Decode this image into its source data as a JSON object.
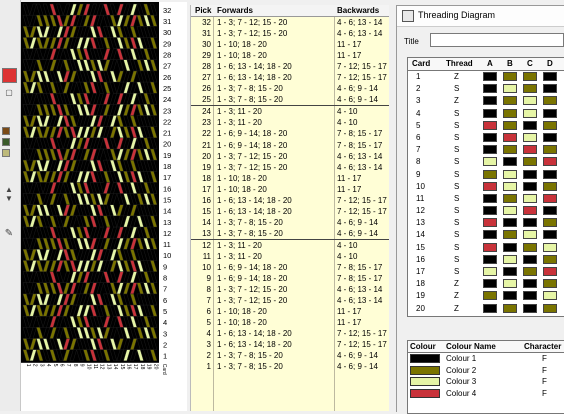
{
  "colors": {
    "colour1": "#000000",
    "colour2": "#7a7400",
    "colour3": "#e6f5a6",
    "colour4": "#c8323a"
  },
  "toolstrip": {
    "icons": [
      "current-colour-red-swatch",
      "colour-swap-icon",
      "palette-swatches-icon",
      "spin-up-icon",
      "spin-down-icon",
      "stamp-tool-icon"
    ]
  },
  "pattern": {
    "row_labels": [
      "32",
      "31",
      "30",
      "29",
      "28",
      "27",
      "26",
      "25",
      "24",
      "23",
      "22",
      "21",
      "20",
      "19",
      "18",
      "17",
      "16",
      "15",
      "14",
      "13",
      "12",
      "11",
      "10",
      "9",
      "8",
      "7",
      "6",
      "5",
      "4",
      "3",
      "2",
      "1"
    ],
    "card_labels": [
      "1",
      "2",
      "3",
      "4",
      "5",
      "6",
      "7",
      "8",
      "9",
      "10",
      "11",
      "12",
      "13",
      "14",
      "15",
      "16",
      "17",
      "18",
      "19",
      "20"
    ],
    "corner_label": "Card"
  },
  "pick_table": {
    "headers": {
      "pick": "Pick",
      "forwards": "Forwards",
      "backwards": "Backwards"
    },
    "rows": [
      {
        "pick": "32",
        "fw": "1 - 3; 7 - 12; 15 - 20",
        "bw": "4 - 6; 13 - 14"
      },
      {
        "pick": "31",
        "fw": "1 - 3; 7 - 12; 15 - 20",
        "bw": "4 - 6; 13 - 14"
      },
      {
        "pick": "30",
        "fw": "1 - 10; 18 - 20",
        "bw": "11 - 17"
      },
      {
        "pick": "29",
        "fw": "1 - 10; 18 - 20",
        "bw": "11 - 17"
      },
      {
        "pick": "28",
        "fw": "1 - 6; 13 - 14; 18 - 20",
        "bw": "7 - 12; 15 - 17"
      },
      {
        "pick": "27",
        "fw": "1 - 6; 13 - 14; 18 - 20",
        "bw": "7 - 12; 15 - 17"
      },
      {
        "pick": "26",
        "fw": "1 - 3; 7 - 8; 15 - 20",
        "bw": "4 - 6; 9 - 14"
      },
      {
        "pick": "25",
        "fw": "1 - 3; 7 - 8; 15 - 20",
        "bw": "4 - 6; 9 - 14",
        "sep": true
      },
      {
        "pick": "24",
        "fw": "1 - 3; 11 - 20",
        "bw": "4 - 10"
      },
      {
        "pick": "23",
        "fw": "1 - 3; 11 - 20",
        "bw": "4 - 10"
      },
      {
        "pick": "22",
        "fw": "1 - 6; 9 - 14; 18 - 20",
        "bw": "7 - 8; 15 - 17"
      },
      {
        "pick": "21",
        "fw": "1 - 6; 9 - 14; 18 - 20",
        "bw": "7 - 8; 15 - 17"
      },
      {
        "pick": "20",
        "fw": "1 - 3; 7 - 12; 15 - 20",
        "bw": "4 - 6; 13 - 14"
      },
      {
        "pick": "19",
        "fw": "1 - 3; 7 - 12; 15 - 20",
        "bw": "4 - 6; 13 - 14"
      },
      {
        "pick": "18",
        "fw": "1 - 10; 18 - 20",
        "bw": "11 - 17"
      },
      {
        "pick": "17",
        "fw": "1 - 10; 18 - 20",
        "bw": "11 - 17"
      },
      {
        "pick": "16",
        "fw": "1 - 6; 13 - 14; 18 - 20",
        "bw": "7 - 12; 15 - 17"
      },
      {
        "pick": "15",
        "fw": "1 - 6; 13 - 14; 18 - 20",
        "bw": "7 - 12; 15 - 17"
      },
      {
        "pick": "14",
        "fw": "1 - 3; 7 - 8; 15 - 20",
        "bw": "4 - 6; 9 - 14"
      },
      {
        "pick": "13",
        "fw": "1 - 3; 7 - 8; 15 - 20",
        "bw": "4 - 6; 9 - 14",
        "sep": true
      },
      {
        "pick": "12",
        "fw": "1 - 3; 11 - 20",
        "bw": "4 - 10"
      },
      {
        "pick": "11",
        "fw": "1 - 3; 11 - 20",
        "bw": "4 - 10"
      },
      {
        "pick": "10",
        "fw": "1 - 6; 9 - 14; 18 - 20",
        "bw": "7 - 8; 15 - 17"
      },
      {
        "pick": "9",
        "fw": "1 - 6; 9 - 14; 18 - 20",
        "bw": "7 - 8; 15 - 17"
      },
      {
        "pick": "8",
        "fw": "1 - 3; 7 - 12; 15 - 20",
        "bw": "4 - 6; 13 - 14"
      },
      {
        "pick": "7",
        "fw": "1 - 3; 7 - 12; 15 - 20",
        "bw": "4 - 6; 13 - 14"
      },
      {
        "pick": "6",
        "fw": "1 - 10; 18 - 20",
        "bw": "11 - 17"
      },
      {
        "pick": "5",
        "fw": "1 - 10; 18 - 20",
        "bw": "11 - 17"
      },
      {
        "pick": "4",
        "fw": "1 - 6; 13 - 14; 18 - 20",
        "bw": "7 - 12; 15 - 17"
      },
      {
        "pick": "3",
        "fw": "1 - 6; 13 - 14; 18 - 20",
        "bw": "7 - 12; 15 - 17"
      },
      {
        "pick": "2",
        "fw": "1 - 3; 7 - 8; 15 - 20",
        "bw": "4 - 6; 9 - 14"
      },
      {
        "pick": "1",
        "fw": "1 - 3; 7 - 8; 15 - 20",
        "bw": "4 - 6; 9 - 14"
      }
    ]
  },
  "threading_window": {
    "title": "Threading Diagram",
    "title_label": "Title",
    "title_value": "",
    "card_headers": {
      "card": "Card",
      "thread": "Thread",
      "holes": [
        "A",
        "B",
        "C",
        "D"
      ]
    },
    "cards": [
      {
        "card": "1",
        "thread": "Z",
        "holes": [
          1,
          2,
          2,
          1
        ]
      },
      {
        "card": "2",
        "thread": "S",
        "holes": [
          1,
          3,
          2,
          1
        ]
      },
      {
        "card": "3",
        "thread": "Z",
        "holes": [
          1,
          2,
          3,
          2
        ]
      },
      {
        "card": "4",
        "thread": "S",
        "holes": [
          1,
          2,
          3,
          1
        ]
      },
      {
        "card": "5",
        "thread": "S",
        "holes": [
          4,
          2,
          1,
          2
        ]
      },
      {
        "card": "6",
        "thread": "S",
        "holes": [
          1,
          4,
          3,
          1
        ]
      },
      {
        "card": "7",
        "thread": "S",
        "holes": [
          1,
          2,
          4,
          2
        ]
      },
      {
        "card": "8",
        "thread": "S",
        "holes": [
          3,
          1,
          2,
          4
        ]
      },
      {
        "card": "9",
        "thread": "S",
        "holes": [
          2,
          3,
          1,
          1
        ]
      },
      {
        "card": "10",
        "thread": "S",
        "holes": [
          4,
          3,
          1,
          2
        ]
      },
      {
        "card": "11",
        "thread": "S",
        "holes": [
          1,
          2,
          3,
          4
        ]
      },
      {
        "card": "12",
        "thread": "S",
        "holes": [
          1,
          3,
          4,
          1
        ]
      },
      {
        "card": "13",
        "thread": "S",
        "holes": [
          4,
          1,
          1,
          2
        ]
      },
      {
        "card": "14",
        "thread": "S",
        "holes": [
          1,
          2,
          3,
          1
        ]
      },
      {
        "card": "15",
        "thread": "S",
        "holes": [
          4,
          1,
          2,
          3
        ]
      },
      {
        "card": "16",
        "thread": "S",
        "holes": [
          1,
          3,
          1,
          2
        ]
      },
      {
        "card": "17",
        "thread": "S",
        "holes": [
          3,
          1,
          2,
          4
        ]
      },
      {
        "card": "18",
        "thread": "Z",
        "holes": [
          1,
          3,
          1,
          2
        ]
      },
      {
        "card": "19",
        "thread": "Z",
        "holes": [
          2,
          1,
          1,
          3
        ]
      },
      {
        "card": "20",
        "thread": "Z",
        "holes": [
          1,
          2,
          1,
          2
        ]
      }
    ],
    "colour_headers": {
      "colour": "Colour",
      "name": "Colour Name",
      "character": "Character"
    },
    "colours": [
      {
        "name": "Colour 1",
        "char": "F",
        "color": "#000000"
      },
      {
        "name": "Colour 2",
        "char": "F",
        "color": "#7a7400"
      },
      {
        "name": "Colour 3",
        "char": "F",
        "color": "#e6f5a6"
      },
      {
        "name": "Colour 4",
        "char": "F",
        "color": "#c8323a"
      }
    ]
  }
}
